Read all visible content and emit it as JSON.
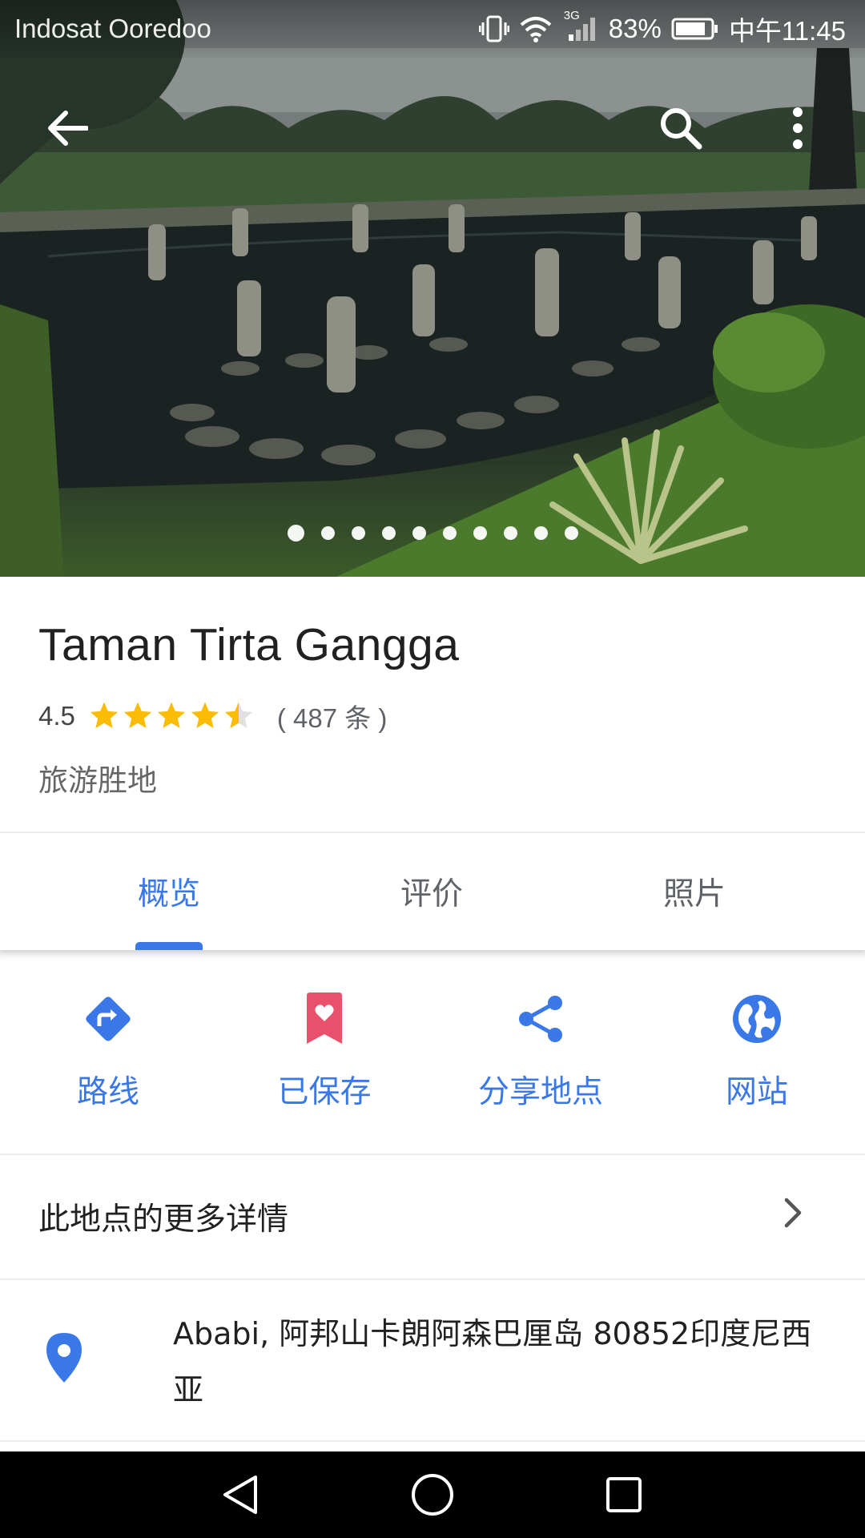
{
  "status_bar": {
    "carrier": "Indosat Ooredoo",
    "network": "3G",
    "battery": "83%",
    "time": "中午11:45"
  },
  "hero": {
    "photo_count": 10,
    "active_photo_index": 0
  },
  "place": {
    "name": "Taman Tirta Gangga",
    "rating": "4.5",
    "rating_value": 4.5,
    "review_count": "( 487 条 )",
    "category": "旅游胜地"
  },
  "tabs": [
    {
      "label": "概览",
      "active": true
    },
    {
      "label": "评价",
      "active": false
    },
    {
      "label": "照片",
      "active": false
    }
  ],
  "actions": [
    {
      "label": "路线",
      "icon": "directions-icon"
    },
    {
      "label": "已保存",
      "icon": "saved-bookmark-icon"
    },
    {
      "label": "分享地点",
      "icon": "share-icon"
    },
    {
      "label": "网站",
      "icon": "globe-icon"
    }
  ],
  "more_details": {
    "label": "此地点的更多详情"
  },
  "address": {
    "text": "Ababi, 阿邦山卡朗阿森巴厘岛 80852印度尼西亚"
  },
  "colors": {
    "accent": "#3b78e7",
    "saved": "#e8506b",
    "star": "#fbbc05",
    "text_primary": "#212121",
    "text_secondary": "#666666"
  }
}
